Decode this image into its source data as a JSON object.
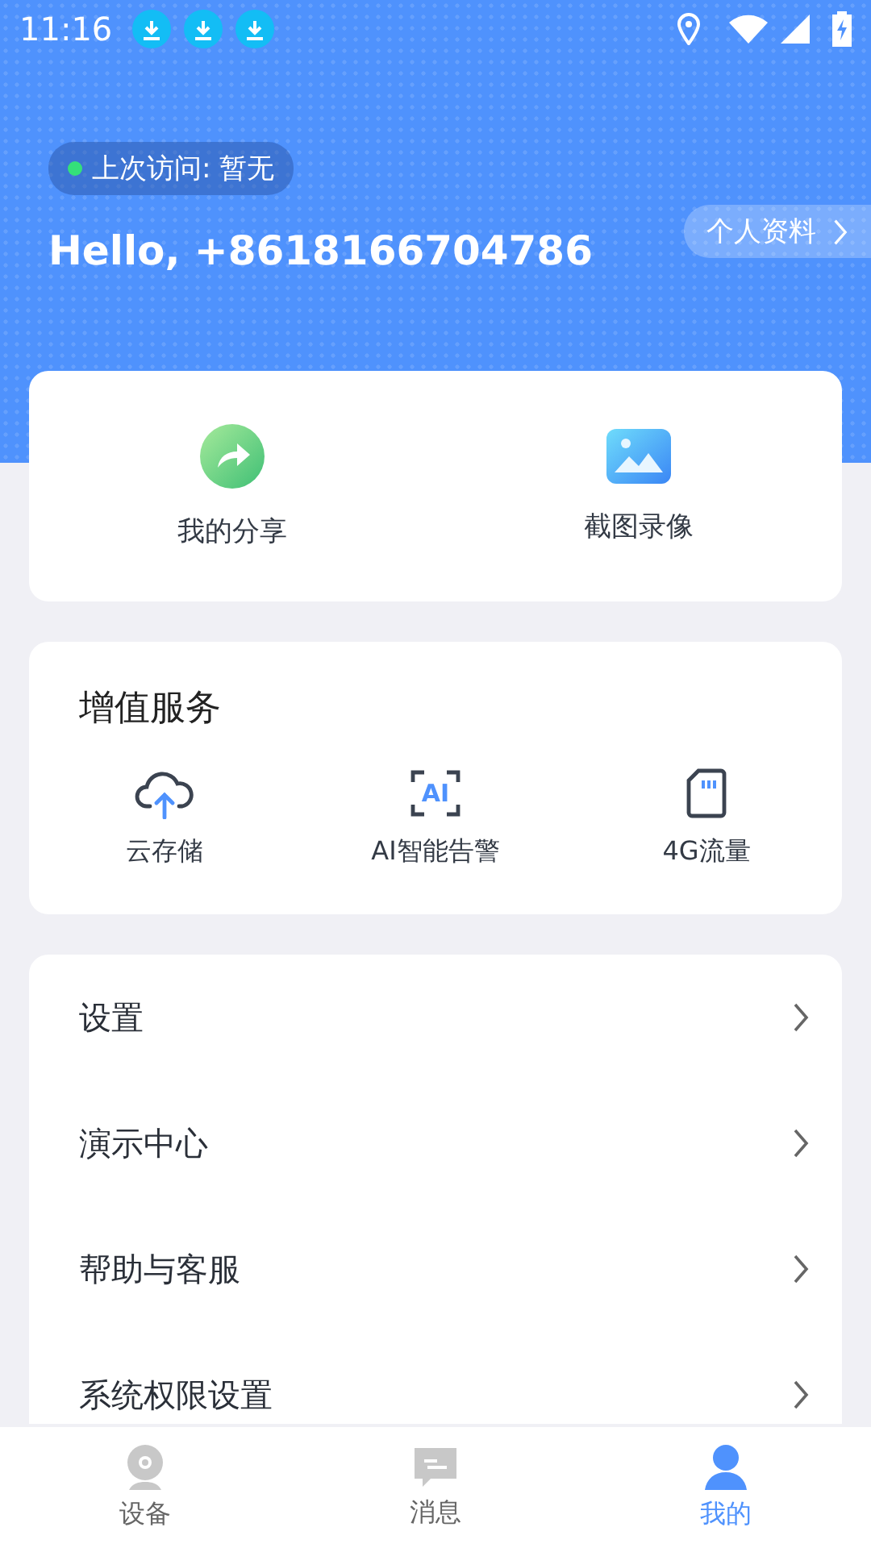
{
  "status_bar": {
    "time": "11:16",
    "notifications": [
      {
        "kind": "download"
      },
      {
        "kind": "download"
      },
      {
        "kind": "download"
      }
    ]
  },
  "header": {
    "last_visit": "上次访问: 暂无",
    "online": true,
    "greeting": "Hello, +8618166704786",
    "profile_button": "个人资料"
  },
  "shortcuts": [
    {
      "kind": "share",
      "label": "我的分享"
    },
    {
      "kind": "gallery",
      "label": "截图录像"
    }
  ],
  "services": {
    "title": "增值服务",
    "items": [
      {
        "kind": "cloud",
        "label": "云存储"
      },
      {
        "kind": "ai",
        "label": "AI智能告警",
        "icon_text": "AI"
      },
      {
        "kind": "sim",
        "label": "4G流量"
      }
    ]
  },
  "menu": [
    {
      "label": "设置"
    },
    {
      "label": "演示中心"
    },
    {
      "label": "帮助与客服"
    },
    {
      "label": "系统权限设置"
    }
  ],
  "tabs": [
    {
      "kind": "camera",
      "label": "设备",
      "selected": false
    },
    {
      "kind": "message",
      "label": "消息",
      "selected": false
    },
    {
      "kind": "person",
      "label": "我的",
      "selected": true
    }
  ]
}
